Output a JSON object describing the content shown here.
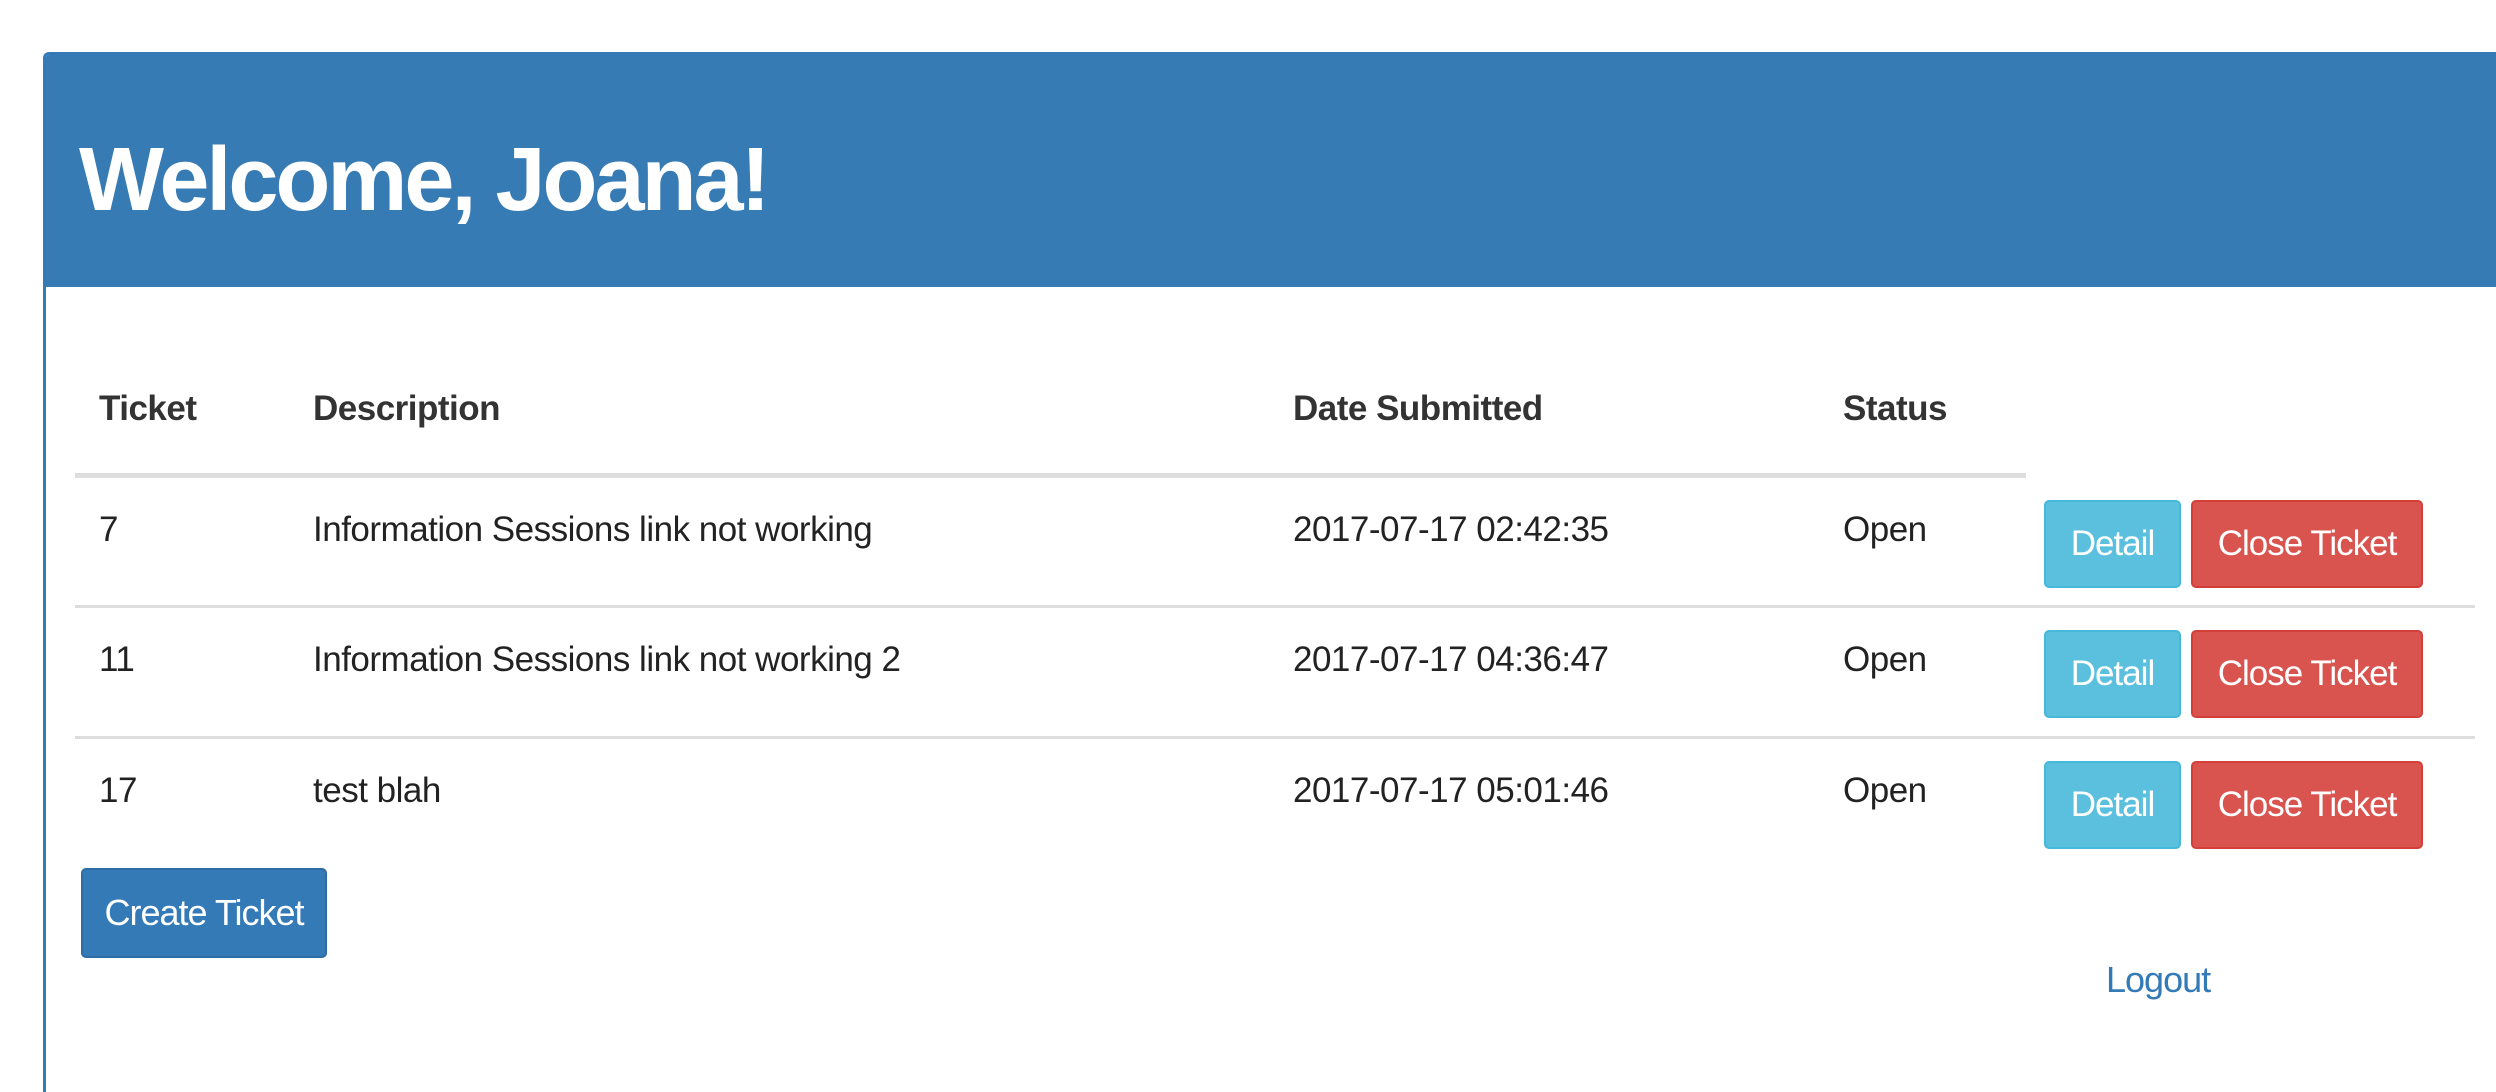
{
  "header": {
    "title": "Welcome, Joana!"
  },
  "table": {
    "columns": [
      "Ticket",
      "Description",
      "Date Submitted",
      "Status",
      ""
    ],
    "rows": [
      {
        "ticket": "7",
        "description": "Information Sessions link not working",
        "date_submitted": "2017-07-17 02:42:35",
        "status": "Open",
        "detail_label": "Detail",
        "close_label": "Close Ticket"
      },
      {
        "ticket": "11",
        "description": "Information Sessions link not working 2",
        "date_submitted": "2017-07-17 04:36:47",
        "status": "Open",
        "detail_label": "Detail",
        "close_label": "Close Ticket"
      },
      {
        "ticket": "17",
        "description": "test blah",
        "date_submitted": "2017-07-17 05:01:46",
        "status": "Open",
        "detail_label": "Detail",
        "close_label": "Close Ticket"
      }
    ]
  },
  "actions": {
    "create_label": "Create Ticket",
    "logout_label": "Logout"
  },
  "colors": {
    "primary": "#337ab7",
    "info": "#5bc0de",
    "danger": "#d9534f"
  }
}
